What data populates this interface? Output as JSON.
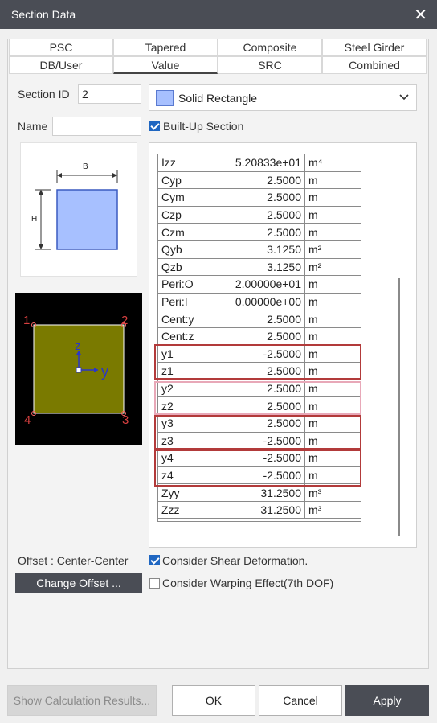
{
  "window": {
    "title": "Section Data",
    "close_glyph": "✕"
  },
  "tabs": {
    "row1": [
      "PSC",
      "Tapered",
      "Composite",
      "Steel Girder"
    ],
    "row2": [
      "DB/User",
      "Value",
      "SRC",
      "Combined"
    ],
    "active": "Value"
  },
  "section_id": {
    "label": "Section ID",
    "value": "2"
  },
  "shape_dropdown": {
    "selected": "Solid Rectangle",
    "icon": "solid-rectangle-icon",
    "chevron": "chevron-down-icon"
  },
  "name": {
    "label": "Name",
    "value": ""
  },
  "built_up": {
    "label": "Built-Up Section",
    "checked": true
  },
  "preview": {
    "dim_b": "B",
    "dim_h": "H"
  },
  "section_view": {
    "axis_y": "y",
    "axis_z": "z",
    "corners": [
      "1",
      "2",
      "3",
      "4"
    ]
  },
  "properties": [
    {
      "name": "Izz",
      "value": "5.20833e+01",
      "unit": "m⁴"
    },
    {
      "name": "Cyp",
      "value": "2.5000",
      "unit": "m"
    },
    {
      "name": "Cym",
      "value": "2.5000",
      "unit": "m"
    },
    {
      "name": "Czp",
      "value": "2.5000",
      "unit": "m"
    },
    {
      "name": "Czm",
      "value": "2.5000",
      "unit": "m"
    },
    {
      "name": "Qyb",
      "value": "3.1250",
      "unit": "m²"
    },
    {
      "name": "Qzb",
      "value": "3.1250",
      "unit": "m²"
    },
    {
      "name": "Peri:O",
      "value": "2.00000e+01",
      "unit": "m"
    },
    {
      "name": "Peri:I",
      "value": "0.00000e+00",
      "unit": "m"
    },
    {
      "name": "Cent:y",
      "value": "2.5000",
      "unit": "m"
    },
    {
      "name": "Cent:z",
      "value": "2.5000",
      "unit": "m"
    },
    {
      "name": "y1",
      "value": "-2.5000",
      "unit": "m"
    },
    {
      "name": "z1",
      "value": "2.5000",
      "unit": "m"
    },
    {
      "name": "y2",
      "value": "2.5000",
      "unit": "m"
    },
    {
      "name": "z2",
      "value": "2.5000",
      "unit": "m"
    },
    {
      "name": "y3",
      "value": "2.5000",
      "unit": "m"
    },
    {
      "name": "z3",
      "value": "-2.5000",
      "unit": "m"
    },
    {
      "name": "y4",
      "value": "-2.5000",
      "unit": "m"
    },
    {
      "name": "z4",
      "value": "-2.5000",
      "unit": "m"
    },
    {
      "name": "Zyy",
      "value": "31.2500",
      "unit": "m³"
    },
    {
      "name": "Zzz",
      "value": "31.2500",
      "unit": "m³"
    }
  ],
  "offset": {
    "label": "Offset : Center-Center",
    "button": "Change Offset ..."
  },
  "shear": {
    "label": "Consider Shear Deformation.",
    "checked": true
  },
  "warping": {
    "label": "Consider Warping Effect(7th DOF)",
    "checked": false
  },
  "footer": {
    "show_calc": "Show Calculation Results...",
    "ok": "OK",
    "cancel": "Cancel",
    "apply": "Apply"
  },
  "colors": {
    "titlebar": "#4a4d55",
    "highlight_box": "#b23a3a",
    "section_fill": "#7a7a00",
    "preview_fill": "#a7c0ff"
  }
}
